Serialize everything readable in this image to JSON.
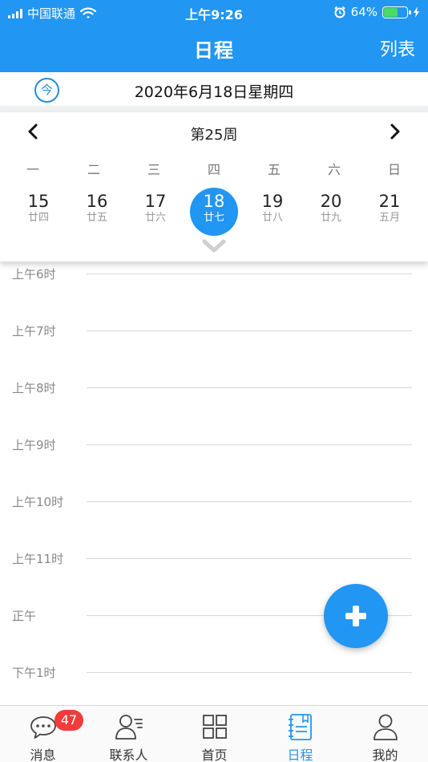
{
  "status_bar": {
    "carrier": "中国联通",
    "time": "上午9:26",
    "battery_percent": "64%",
    "battery_level": 0.64,
    "icons": [
      "signal-icon",
      "wifi-icon",
      "alarm-icon",
      "battery-icon",
      "charging-icon"
    ]
  },
  "nav": {
    "title": "日程",
    "list_button": "列表"
  },
  "date_row": {
    "today_button": "今",
    "date_text": "2020年6月18日星期四"
  },
  "week": {
    "label": "第25周",
    "weekdays": [
      "一",
      "二",
      "三",
      "四",
      "五",
      "六",
      "日"
    ],
    "days": [
      {
        "num": "15",
        "lunar": "廿四"
      },
      {
        "num": "16",
        "lunar": "廿五"
      },
      {
        "num": "17",
        "lunar": "廿六"
      },
      {
        "num": "18",
        "lunar": "廿七"
      },
      {
        "num": "19",
        "lunar": "廿八"
      },
      {
        "num": "20",
        "lunar": "廿九"
      },
      {
        "num": "21",
        "lunar": "五月"
      }
    ],
    "selected_index": 3
  },
  "timegrid": {
    "slots": [
      "上午6时",
      "上午7时",
      "上午8时",
      "上午9时",
      "上午10时",
      "上午11时",
      "正午",
      "下午1时"
    ]
  },
  "fab": {
    "icon": "plus-icon"
  },
  "tabbar": {
    "tabs": [
      {
        "label": "消息",
        "icon": "chat-bubble-icon",
        "badge": "47"
      },
      {
        "label": "联系人",
        "icon": "contacts-icon"
      },
      {
        "label": "首页",
        "icon": "grid-icon"
      },
      {
        "label": "日程",
        "icon": "schedule-icon",
        "active": true
      },
      {
        "label": "我的",
        "icon": "person-icon"
      }
    ]
  },
  "colors": {
    "primary": "#2196f3",
    "badge": "#f23b3b",
    "battery": "#4cd964",
    "today_ring": "#2a8bd6"
  }
}
